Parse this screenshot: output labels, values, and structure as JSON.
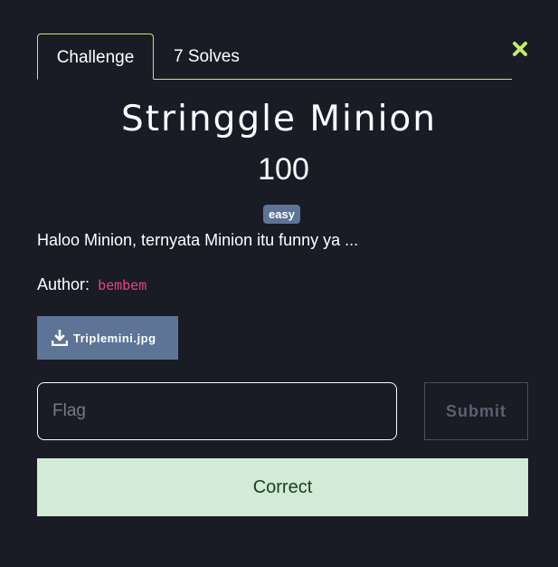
{
  "tabs": [
    {
      "label": "Challenge",
      "active": true
    },
    {
      "label": "7 Solves",
      "active": false
    }
  ],
  "close_icon": "close-icon",
  "challenge": {
    "title": "Stringgle Minion",
    "points": "100",
    "difficulty": "easy",
    "description": "Haloo Minion, ternyata Minion itu funny ya ...",
    "author_label": "Author:",
    "author_name": "bembem"
  },
  "file": {
    "icon": "download-icon",
    "name": "Triplemini.jpg"
  },
  "form": {
    "flag_placeholder": "Flag",
    "flag_value": "",
    "submit_label": "Submit"
  },
  "result": {
    "message": "Correct",
    "status": "success"
  },
  "colors": {
    "background": "#191b25",
    "accent": "#c7e96d",
    "badge": "#5d7497",
    "author": "#e8437f",
    "success_bg": "#d3ead7",
    "success_text": "#173e1f"
  }
}
